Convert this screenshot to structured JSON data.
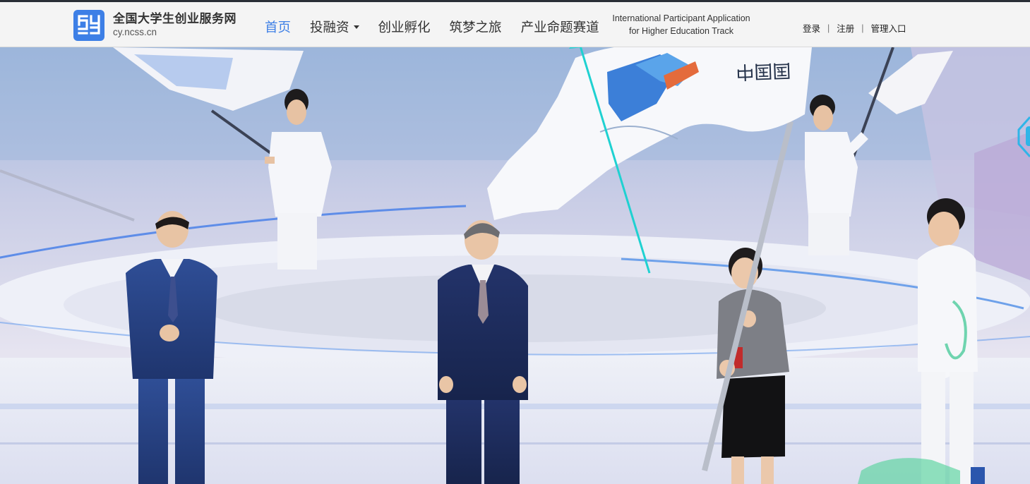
{
  "brand": {
    "title": "全国大学生创业服务网",
    "domain": "cy.ncss.cn",
    "accent_color": "#3d7fe6"
  },
  "nav": {
    "items": [
      {
        "label": "首页",
        "active": true
      },
      {
        "label": "投融资",
        "dropdown": true
      },
      {
        "label": "创业孵化"
      },
      {
        "label": "筑梦之旅"
      },
      {
        "label": "产业命题赛道"
      }
    ],
    "international": {
      "line1": "International Participant Application",
      "line2": "for Higher Education Track"
    }
  },
  "account": {
    "login": "登录",
    "separator": "|",
    "register": "注册",
    "admin": "管理入口"
  },
  "hero": {
    "flag_text": "国国中",
    "pointer_color": "#1fd1d1"
  }
}
